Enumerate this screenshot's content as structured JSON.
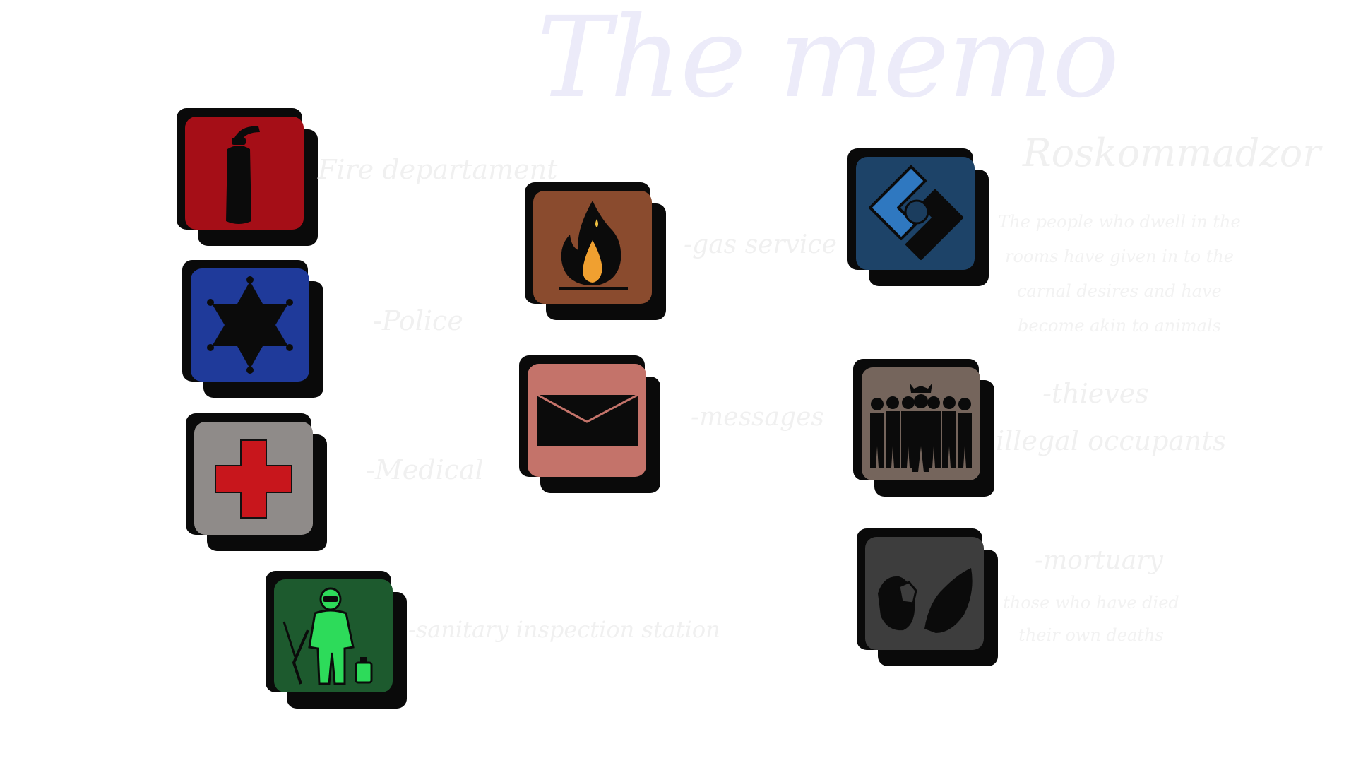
{
  "title": "The memo",
  "colors": {
    "fire_tile": "#a50e17",
    "police_tile": "#1f3a9a",
    "medical_tile": "#8f8b89",
    "sanitary_tile": "#1d5a2e",
    "gas_tile": "#8a4b2e",
    "messages_tile": "#c4736a",
    "roskom_tile": "#1d4368",
    "thieves_tile": "#75655c",
    "mortuary_tile": "#3d3d3d"
  },
  "entries": {
    "fire": {
      "icon": "fire-extinguisher-icon",
      "label": "Fire departament"
    },
    "police": {
      "icon": "sheriff-star-icon",
      "label": "-Police"
    },
    "medical": {
      "icon": "red-cross-icon",
      "label": "-Medical"
    },
    "sanitary": {
      "icon": "hazmat-worker-icon",
      "label": "-sanitary inspection station"
    },
    "gas": {
      "icon": "flame-icon",
      "label": "-gas service"
    },
    "messages": {
      "icon": "envelope-icon",
      "label": "-messages"
    },
    "roskom": {
      "icon": "roskomnadzor-logo-icon",
      "label": "Roskommadzor",
      "description": "The people who dwell in the rooms have given in to the carnal desires and have become akin to animals"
    },
    "thieves": {
      "icon": "crowd-icon",
      "label": "-thieves",
      "label2": "illegal occupants"
    },
    "mortuary": {
      "icon": "tombstones-icon",
      "label": "-mortuary",
      "description": "those who have died their own deaths"
    }
  }
}
